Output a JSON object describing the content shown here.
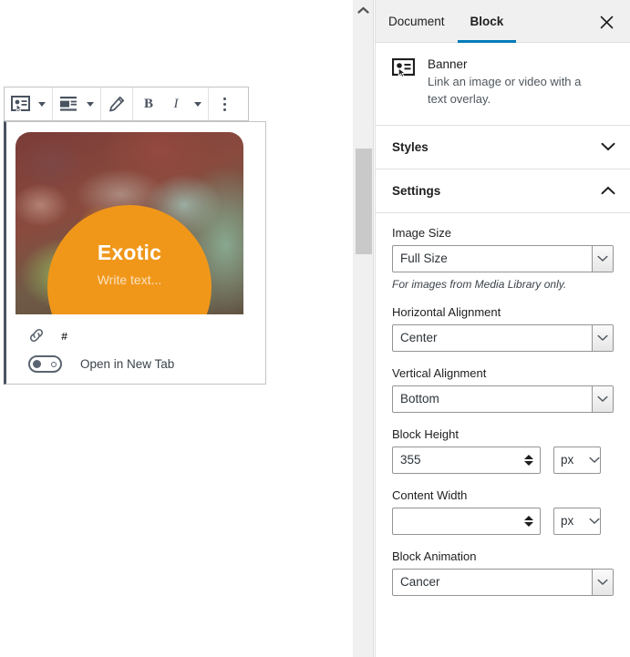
{
  "editor": {
    "toolbar": {
      "block_type_icon": "banner-block-icon",
      "block_type_caret": "chevron-down-icon",
      "align_icon": "align-left-icon",
      "align_caret": "chevron-down-icon",
      "edit_icon": "pencil-icon",
      "bold_label": "B",
      "italic_label": "I",
      "more_formats_caret": "chevron-down-icon",
      "more_options_icon": "vertical-dots-icon"
    },
    "banner": {
      "title": "Exotic",
      "subtitle_placeholder": "Write text...",
      "circle_color": "#f0971a",
      "image_alt": "chameleon-photo"
    },
    "link": {
      "icon": "link-icon",
      "url": "#",
      "new_tab_label": "Open in New Tab",
      "new_tab_enabled": "off"
    }
  },
  "scrollbar": {
    "up_arrow_icon": "chevron-up-icon"
  },
  "inspector": {
    "tabs": [
      {
        "label": "Document",
        "active": false
      },
      {
        "label": "Block",
        "active": true
      }
    ],
    "close_icon": "close-icon",
    "accent_color": "#007cba",
    "block_card": {
      "icon": "banner-block-icon",
      "name": "Banner",
      "description": "Link an image or video with a text overlay."
    },
    "panels": [
      {
        "title": "Styles",
        "expanded": false,
        "chevron": "chevron-down-icon"
      },
      {
        "title": "Settings",
        "expanded": true,
        "chevron": "chevron-up-icon"
      }
    ],
    "settings": {
      "image_size": {
        "label": "Image Size",
        "value": "Full Size",
        "help": "For images from Media Library only."
      },
      "horizontal_alignment": {
        "label": "Horizontal Alignment",
        "value": "Center"
      },
      "vertical_alignment": {
        "label": "Vertical Alignment",
        "value": "Bottom"
      },
      "block_height": {
        "label": "Block Height",
        "value": "355",
        "unit": "px"
      },
      "content_width": {
        "label": "Content Width",
        "value": "",
        "unit": "px"
      },
      "block_animation": {
        "label": "Block Animation",
        "value": "Cancer"
      }
    }
  }
}
